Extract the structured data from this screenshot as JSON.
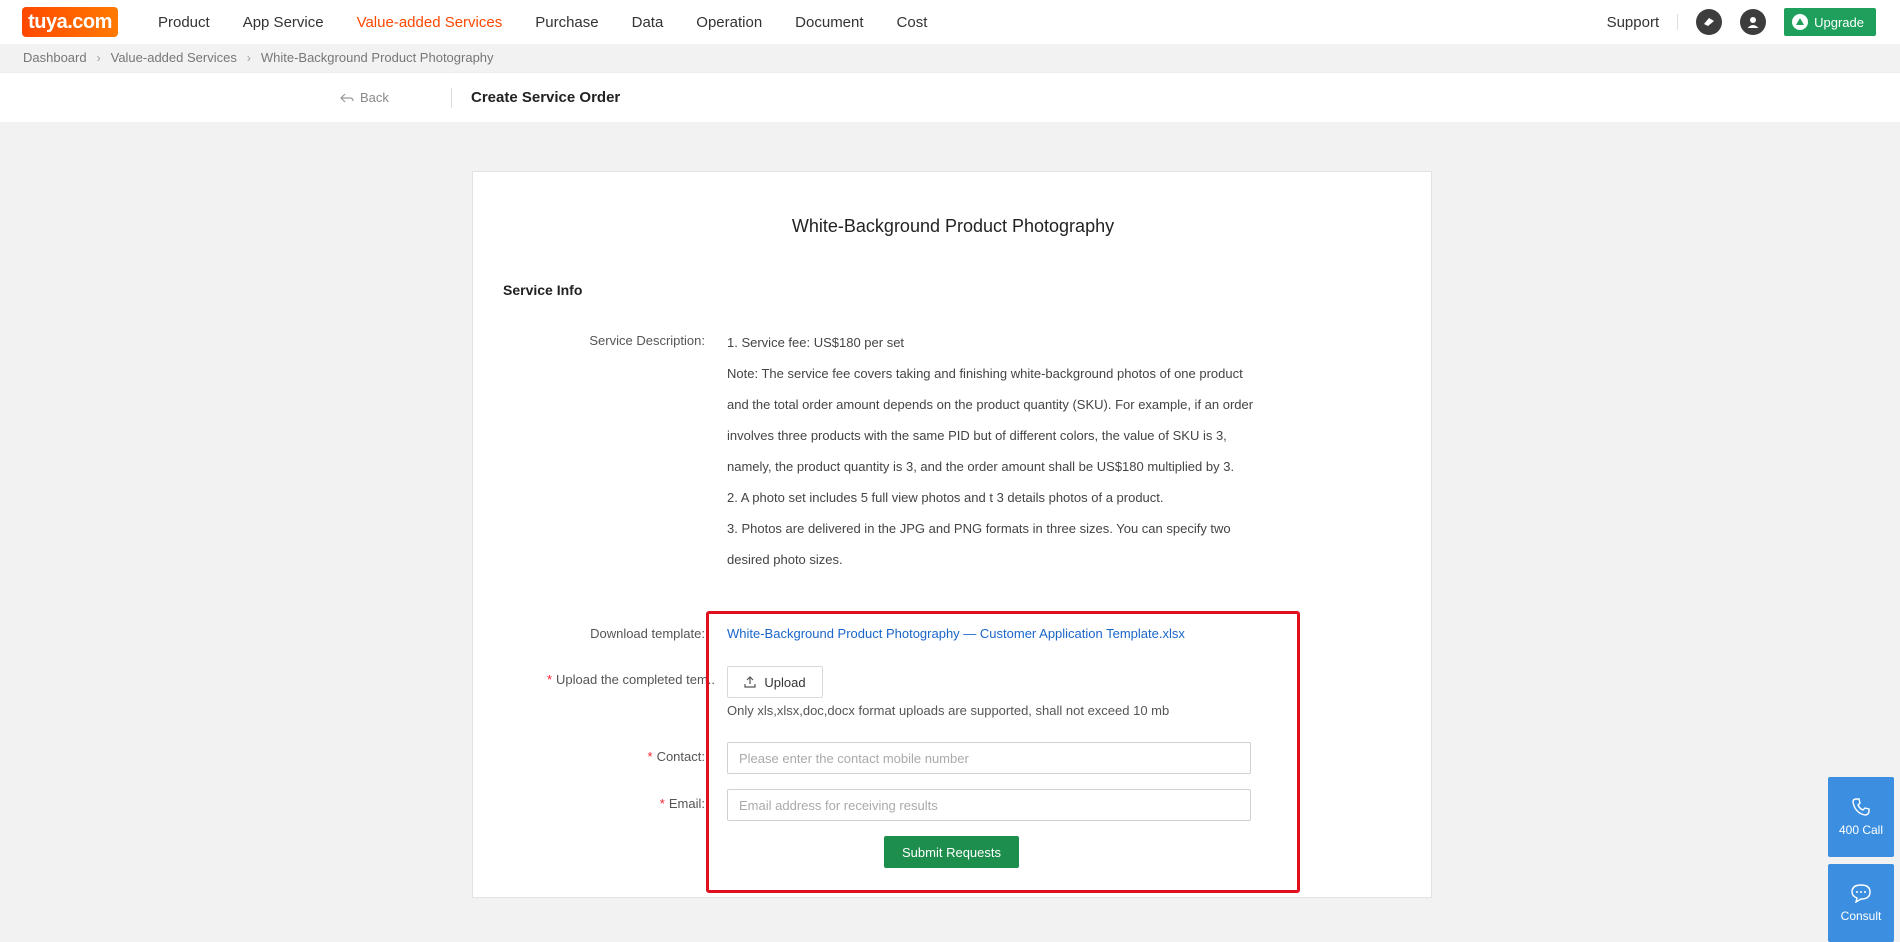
{
  "brand": {
    "logo_text": "tuya.com"
  },
  "nav": {
    "items": [
      {
        "label": "Product"
      },
      {
        "label": "App Service"
      },
      {
        "label": "Value-added Services",
        "active": true
      },
      {
        "label": "Purchase"
      },
      {
        "label": "Data"
      },
      {
        "label": "Operation"
      },
      {
        "label": "Document"
      },
      {
        "label": "Cost"
      }
    ],
    "support": "Support",
    "upgrade": "Upgrade"
  },
  "breadcrumb": [
    "Dashboard",
    "Value-added Services",
    "White-Background Product Photography"
  ],
  "subheader": {
    "back": "Back",
    "title": "Create Service Order"
  },
  "form": {
    "title": "White-Background Product Photography",
    "section": "Service Info",
    "description_label": "Service Description",
    "description": [
      "1. Service fee: US$180 per set",
      "Note: The service fee covers taking and finishing white-background photos of one product and the total order amount depends on the product quantity (SKU). For example, if an order involves three products with the same PID but of different colors, the value of SKU is 3, namely, the product quantity is 3, and the order amount shall be US$180 multiplied by 3.",
      "2. A photo set includes 5 full view photos and t 3 details photos of a product.",
      "3. Photos are delivered in the JPG and PNG formats in three sizes. You can specify two desired photo sizes."
    ],
    "download_label": "Download template",
    "template_link": "White-Background Product Photography — Customer Application Template.xlsx",
    "upload_label": "Upload the completed tem..",
    "upload_button": "Upload",
    "upload_hint": "Only xls,xlsx,doc,docx format uploads are supported,  shall not exceed 10 mb",
    "contact_label": "Contact",
    "contact_placeholder": "Please enter the contact mobile number",
    "email_label": "Email",
    "email_placeholder": "Email address for receiving results",
    "submit": "Submit Requests",
    "label_suffix": ":",
    "required_mark": "*"
  },
  "floating": {
    "call": "400 Call",
    "consult": "Consult"
  },
  "colors": {
    "accent": "#ff4800",
    "primary_green": "#1e8e4d",
    "link": "#1a66c9",
    "highlight": "#e01020",
    "float": "#3c8fe0"
  }
}
